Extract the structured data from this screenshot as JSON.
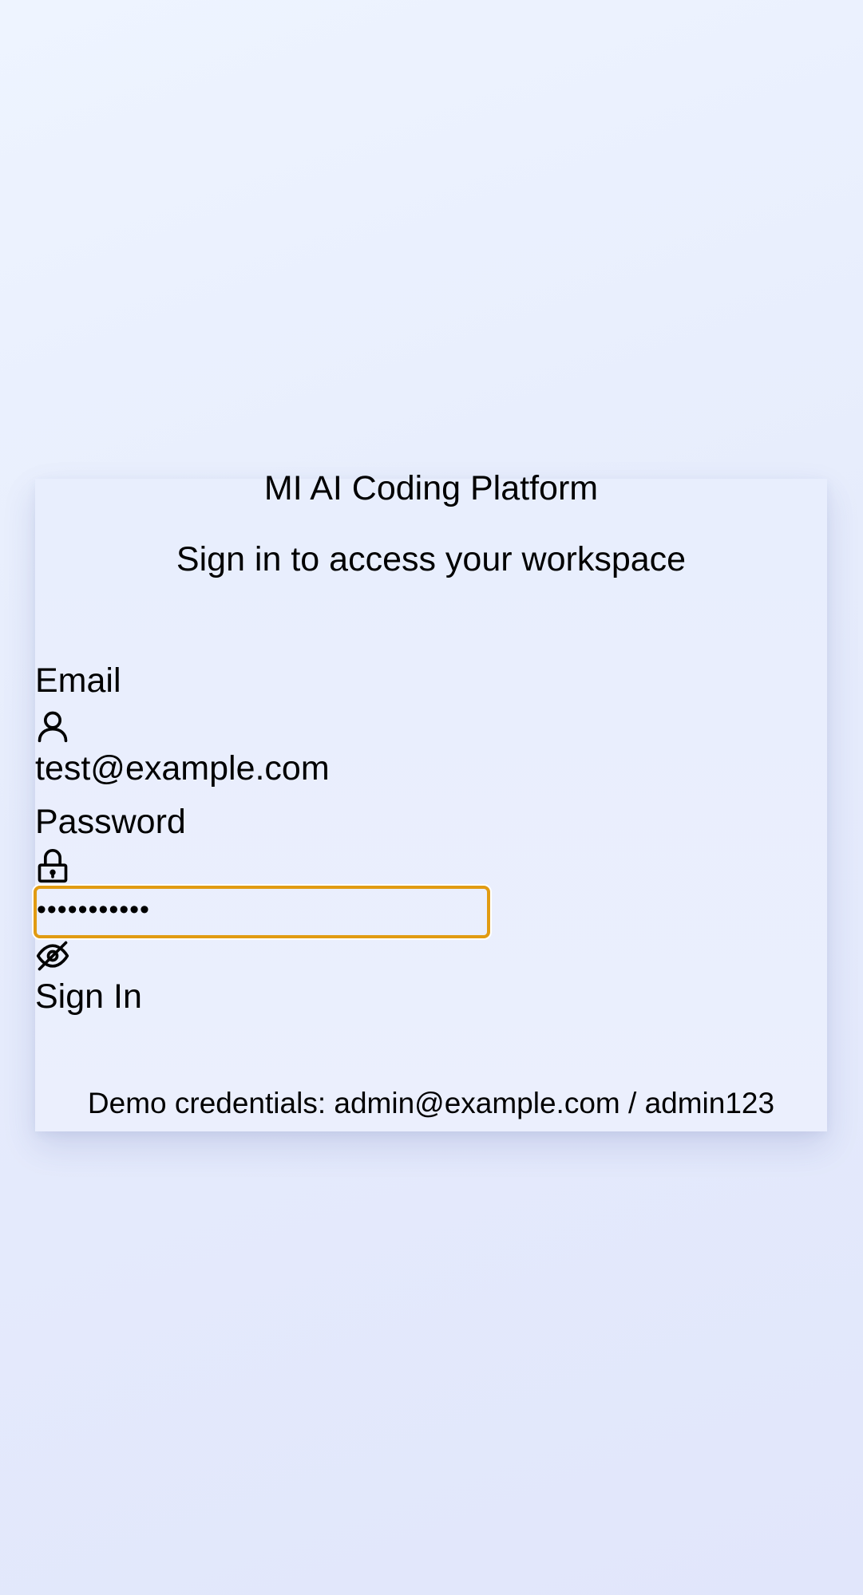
{
  "header": {
    "title": "MI AI Coding Platform",
    "subtitle": "Sign in to access your workspace"
  },
  "form": {
    "email_label": "Email",
    "email_value": "test@example.com",
    "password_label": "Password",
    "password_value": "•••••••••••",
    "sign_in_label": "Sign In"
  },
  "icons": {
    "email": "user-icon",
    "password": "lock-icon",
    "toggle": "eye-off-icon"
  },
  "footer": {
    "demo_text": "Demo credentials: admin@example.com / admin123"
  },
  "colors": {
    "focus_ring": "#e19b12",
    "card_background": "#e8eefd",
    "page_background": "#e6ecfc"
  }
}
